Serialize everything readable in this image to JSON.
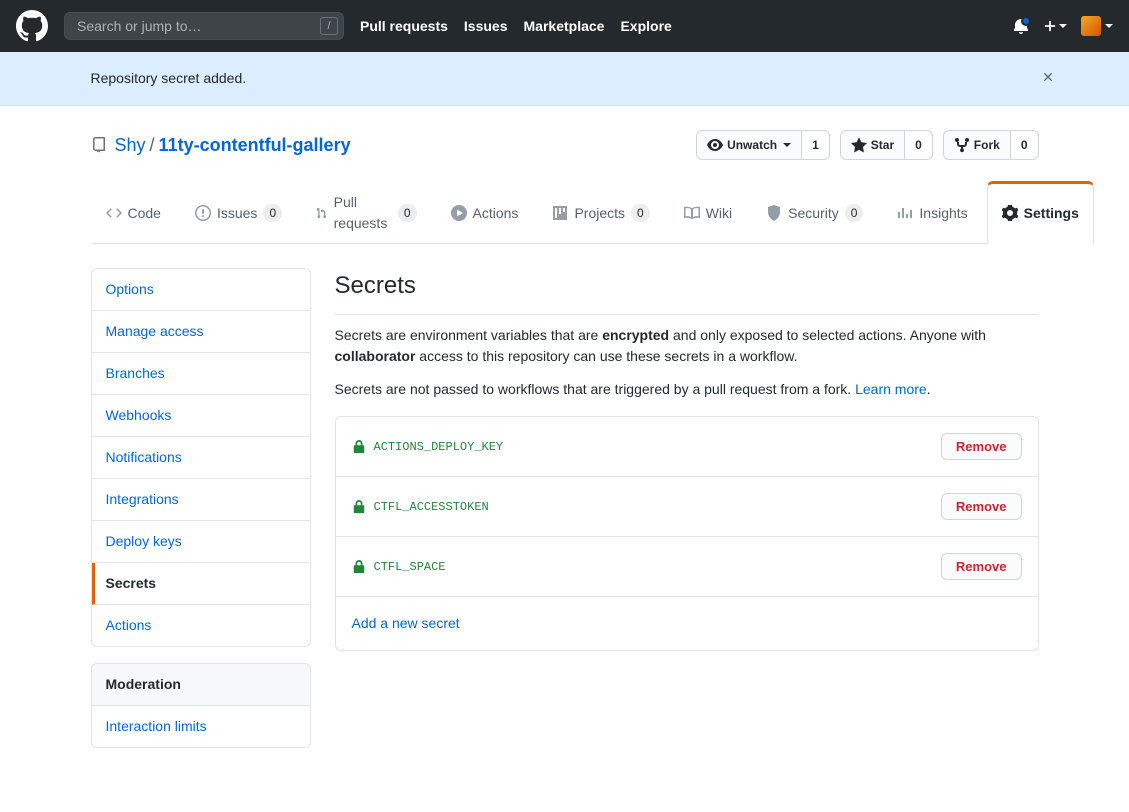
{
  "header": {
    "search_placeholder": "Search or jump to…",
    "nav": {
      "pulls": "Pull requests",
      "issues": "Issues",
      "marketplace": "Marketplace",
      "explore": "Explore"
    }
  },
  "flash": {
    "message": "Repository secret added."
  },
  "repo": {
    "owner": "Shy",
    "name": "11ty-contentful-gallery",
    "separator": "/",
    "watch_label": "Unwatch",
    "watch_count": "1",
    "star_label": "Star",
    "star_count": "0",
    "fork_label": "Fork",
    "fork_count": "0"
  },
  "tabs": {
    "code": "Code",
    "issues": "Issues",
    "issues_count": "0",
    "pulls": "Pull requests",
    "pulls_count": "0",
    "actions": "Actions",
    "projects": "Projects",
    "projects_count": "0",
    "wiki": "Wiki",
    "security": "Security",
    "security_count": "0",
    "insights": "Insights",
    "settings": "Settings"
  },
  "sidebar": {
    "items": {
      "options": "Options",
      "manage_access": "Manage access",
      "branches": "Branches",
      "webhooks": "Webhooks",
      "notifications": "Notifications",
      "integrations": "Integrations",
      "deploy_keys": "Deploy keys",
      "secrets": "Secrets",
      "actions": "Actions"
    },
    "moderation_header": "Moderation",
    "moderation": {
      "interaction_limits": "Interaction limits"
    }
  },
  "page": {
    "title": "Secrets",
    "p1a": "Secrets are environment variables that are ",
    "p1b": "encrypted",
    "p1c": " and only exposed to selected actions. Anyone with ",
    "p1d": "collaborator",
    "p1e": " access to this repository can use these secrets in a workflow.",
    "p2a": "Secrets are not passed to workflows that are triggered by a pull request from a fork. ",
    "learn_more": "Learn more",
    "period": ".",
    "remove_label": "Remove",
    "add_label": "Add a new secret",
    "secrets": [
      {
        "name": "ACTIONS_DEPLOY_KEY"
      },
      {
        "name": "CTFL_ACCESSTOKEN"
      },
      {
        "name": "CTFL_SPACE"
      }
    ]
  }
}
